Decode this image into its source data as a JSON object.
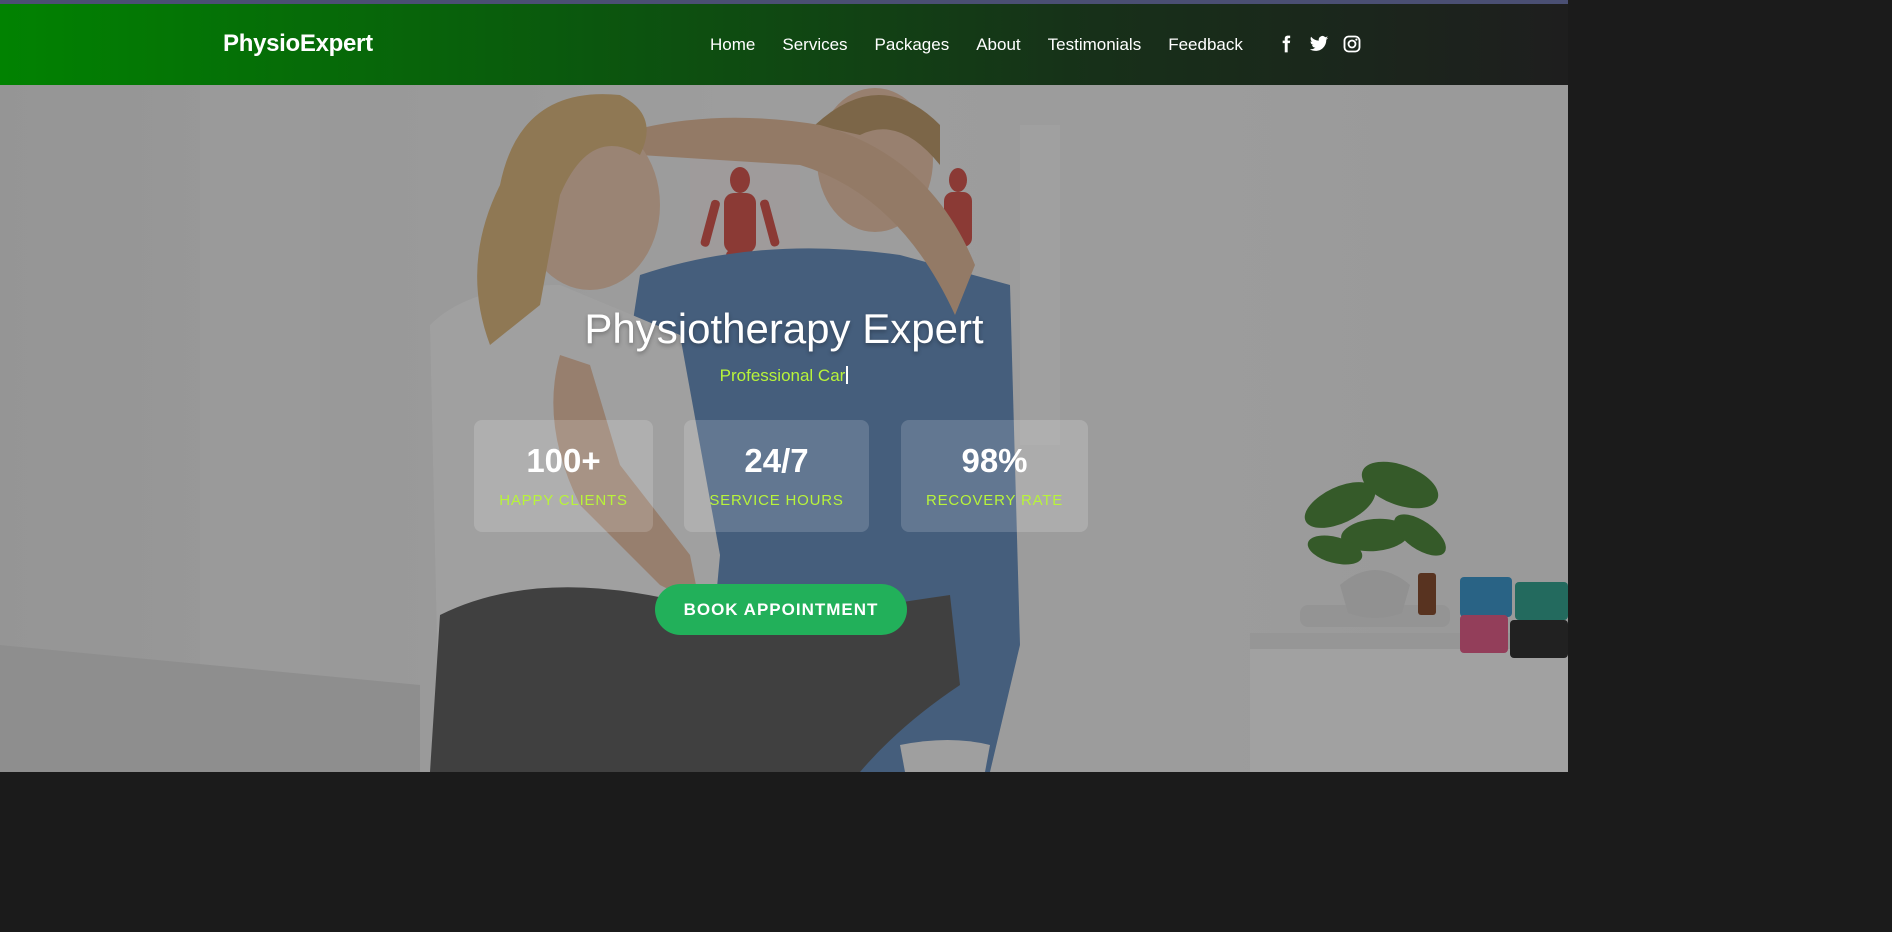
{
  "nav": {
    "logo": "PhysioExpert",
    "links": [
      "Home",
      "Services",
      "Packages",
      "About",
      "Testimonials",
      "Feedback"
    ],
    "social_icons": [
      "facebook-icon",
      "twitter-icon",
      "instagram-icon"
    ]
  },
  "hero": {
    "title": "Physiotherapy Expert",
    "typing_text": "Professional Car",
    "stats": [
      {
        "value": "100+",
        "label": "HAPPY CLIENTS"
      },
      {
        "value": "24/7",
        "label": "SERVICE HOURS"
      },
      {
        "value": "98%",
        "label": "RECOVERY RATE"
      }
    ],
    "cta": "BOOK APPOINTMENT"
  },
  "colors": {
    "nav_gradient_start": "#018201",
    "nav_gradient_end": "#1e1e1e",
    "accent_text": "#b8f43a",
    "cta_green": "#22b05a"
  }
}
